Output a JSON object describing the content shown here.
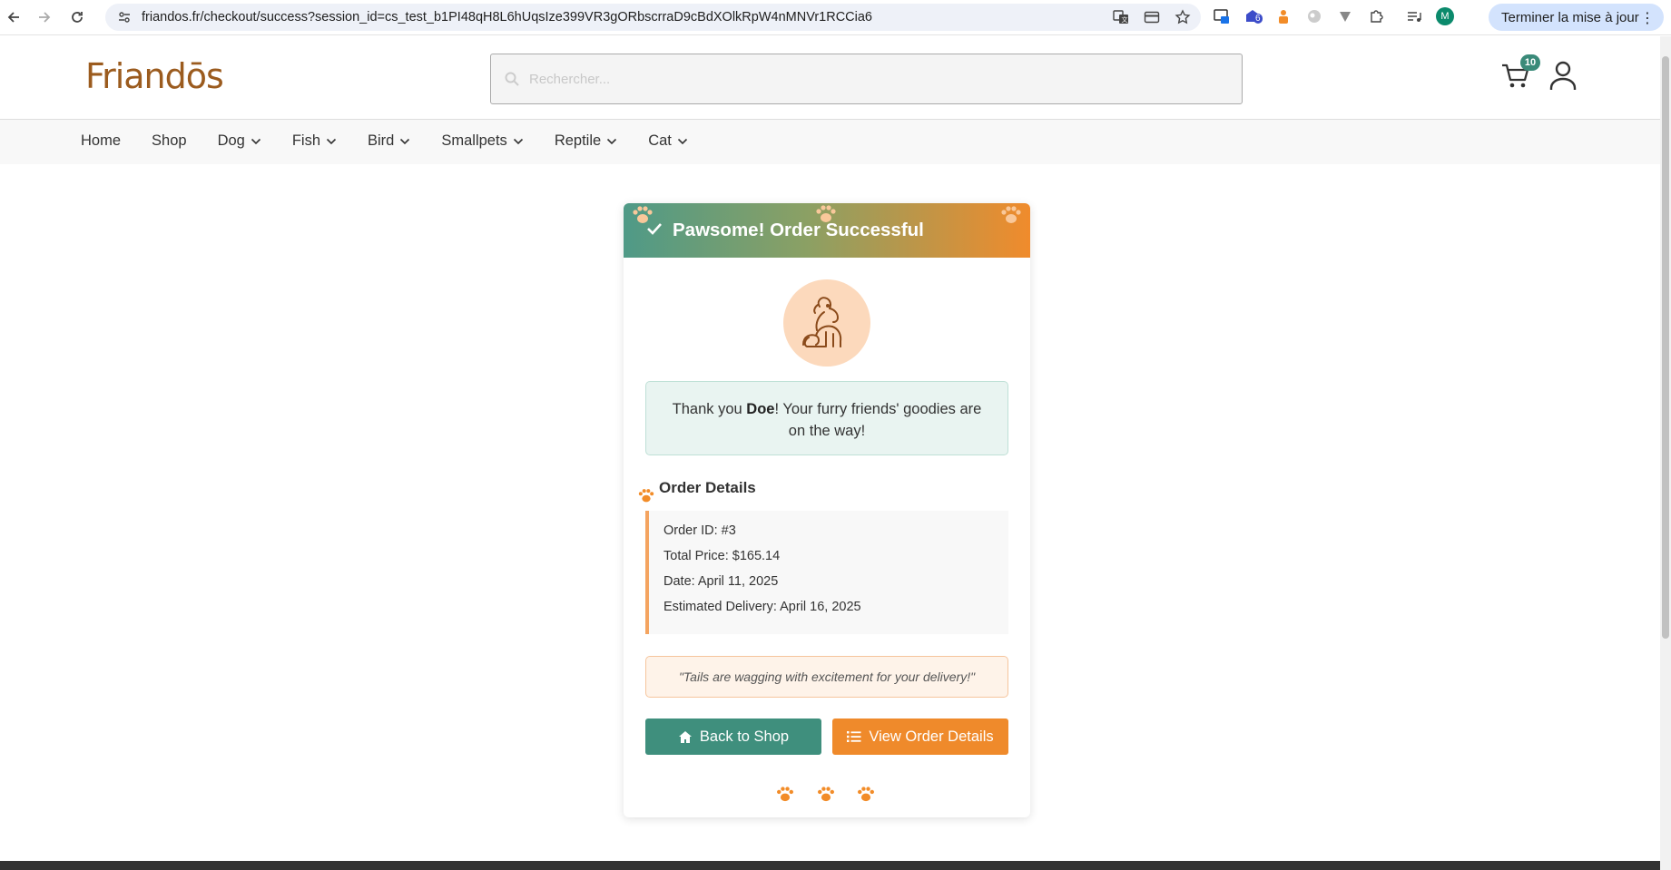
{
  "browser": {
    "url": "friandos.fr/checkout/success?session_id=cs_test_b1PI48qH8L6hUqsIze399VR3gORbscrraD9cBdXOlkRpW4nMNVr1RCCia6",
    "update_button": "Terminer la mise à jour",
    "profile_initial": "M",
    "extension_badge": "6"
  },
  "header": {
    "logo": "Friandōs",
    "search_placeholder": "Rechercher...",
    "cart_count": "10"
  },
  "nav": {
    "items": [
      {
        "label": "Home",
        "dropdown": false
      },
      {
        "label": "Shop",
        "dropdown": false
      },
      {
        "label": "Dog",
        "dropdown": true
      },
      {
        "label": "Fish",
        "dropdown": true
      },
      {
        "label": "Bird",
        "dropdown": true
      },
      {
        "label": "Smallpets",
        "dropdown": true
      },
      {
        "label": "Reptile",
        "dropdown": true
      },
      {
        "label": "Cat",
        "dropdown": true
      }
    ]
  },
  "card": {
    "title": "Pawsome! Order Successful",
    "thanks_prefix": "Thank you ",
    "customer_name": "Doe",
    "thanks_suffix": "! Your furry friends' goodies are on the way!",
    "order_details_title": "Order Details",
    "order_id": "Order ID: #3",
    "total_price": "Total Price: $165.14",
    "date": "Date: April 11, 2025",
    "estimated_delivery": "Estimated Delivery: April 16, 2025",
    "quote": "\"Tails are wagging with excitement for your delivery!\"",
    "back_button": "Back to Shop",
    "orders_button": "View Order Details"
  },
  "colors": {
    "primary": "#3f8f7d",
    "accent": "#ef8a2b",
    "brand": "#9b5b1e"
  }
}
